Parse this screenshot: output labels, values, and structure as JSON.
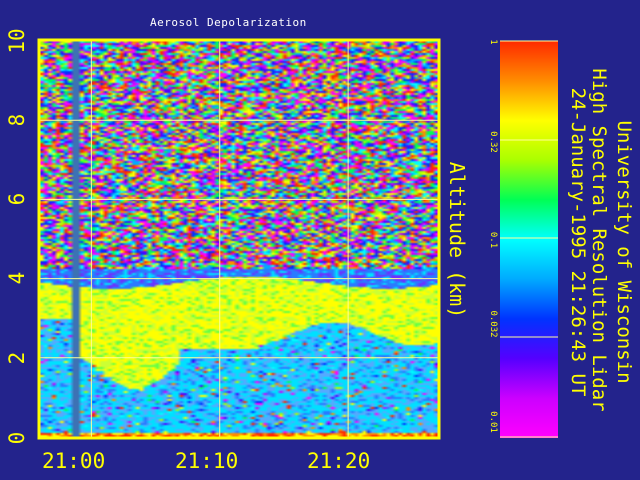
{
  "header": {
    "line1": "University of Wisconsin",
    "line2": "High Spectral Resolution Lidar",
    "line3": "24-January-1995 21:26:43 UT"
  },
  "colors": {
    "background": "#23238c",
    "axis": "#ffff00",
    "title_text": "#ffffff",
    "gap_column": "#3d72b4"
  },
  "chart_data": {
    "type": "heatmap",
    "title": "Aerosol Depolarization",
    "xlabel": "",
    "ylabel": "Altitude (km)",
    "x_axis": {
      "unit": "UT time",
      "range": [
        "20:56",
        "21:27"
      ],
      "ticks": [
        "21:00",
        "21:10",
        "21:20"
      ],
      "grid": true
    },
    "y_axis": {
      "unit": "km",
      "range": [
        0,
        10
      ],
      "ticks": [
        "0",
        "2",
        "4",
        "6",
        "8",
        "10"
      ],
      "grid": true
    },
    "colorbar": {
      "scale": "log",
      "range": [
        0.01,
        1
      ],
      "ticks": [
        "1",
        "0.32",
        "0.1",
        "0.032",
        "0.01"
      ],
      "colors_top_to_bottom": [
        "#ff2a00",
        "#ff8c00",
        "#ffff00",
        "#aaff00",
        "#00ff55",
        "#00ffff",
        "#00aaff",
        "#0033ff",
        "#5500ff",
        "#cc00ff",
        "#ff00ff"
      ]
    },
    "features": [
      {
        "name": "noisy free troposphere",
        "altitude_km": [
          4.2,
          10
        ],
        "depolarization": "random noise 0.01-1"
      },
      {
        "name": "thin blue layer",
        "altitude_km": [
          3.9,
          4.2
        ],
        "depolarization_approx": 0.03
      },
      {
        "name": "depolarizing cloud layer",
        "altitude_km": [
          1.5,
          3.9
        ],
        "time_range": [
          "20:59",
          "21:27"
        ],
        "depolarization_approx": 0.3
      },
      {
        "name": "boundary layer",
        "altitude_km": [
          0,
          2.0
        ],
        "depolarization_approx": 0.05
      },
      {
        "name": "data gap",
        "time_range": [
          "20:58",
          "20:59"
        ]
      }
    ]
  }
}
